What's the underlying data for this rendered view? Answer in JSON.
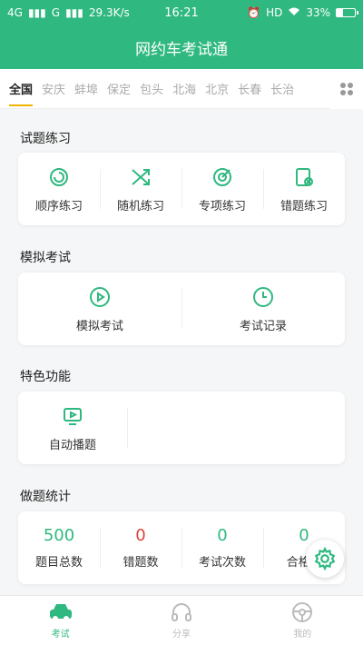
{
  "status_bar": {
    "left": [
      "4G",
      "G",
      "29.3K/s"
    ],
    "time": "16:21",
    "right": [
      "HD",
      "33%"
    ],
    "battery_level": 0.33
  },
  "app_bar": {
    "title": "网约车考试通"
  },
  "city_tabs": {
    "items": [
      "全国",
      "安庆",
      "蚌埠",
      "保定",
      "包头",
      "北海",
      "北京",
      "长春",
      "长治"
    ],
    "active": "全国"
  },
  "practice": {
    "title": "试题练习",
    "items": [
      {
        "label": "顺序练习",
        "icon": "sequence-icon"
      },
      {
        "label": "随机练习",
        "icon": "shuffle-icon"
      },
      {
        "label": "专项练习",
        "icon": "target-icon"
      },
      {
        "label": "错题练习",
        "icon": "wrong-list-icon"
      }
    ]
  },
  "mock_exam": {
    "title": "模拟考试",
    "items": [
      {
        "label": "模拟考试",
        "icon": "play-icon"
      },
      {
        "label": "考试记录",
        "icon": "clock-icon"
      }
    ]
  },
  "features": {
    "title": "特色功能",
    "items": [
      {
        "label": "自动播题",
        "icon": "video-icon"
      }
    ]
  },
  "stats": {
    "title": "做题统计",
    "items": [
      {
        "value": "500",
        "label": "题目总数"
      },
      {
        "value": "0",
        "label": "错题数"
      },
      {
        "value": "0",
        "label": "考试次数"
      },
      {
        "value": "0",
        "label": "合格..."
      }
    ]
  },
  "bottom_nav": {
    "items": [
      {
        "label": "考试",
        "icon": "car-icon"
      },
      {
        "label": "分享",
        "icon": "headphone-icon"
      },
      {
        "label": "我的",
        "icon": "steering-wheel-icon"
      }
    ],
    "active": "考试"
  },
  "colors": {
    "brand": "#2fb87f",
    "error": "#d9443a",
    "tab_indicator": "#f0b400"
  }
}
